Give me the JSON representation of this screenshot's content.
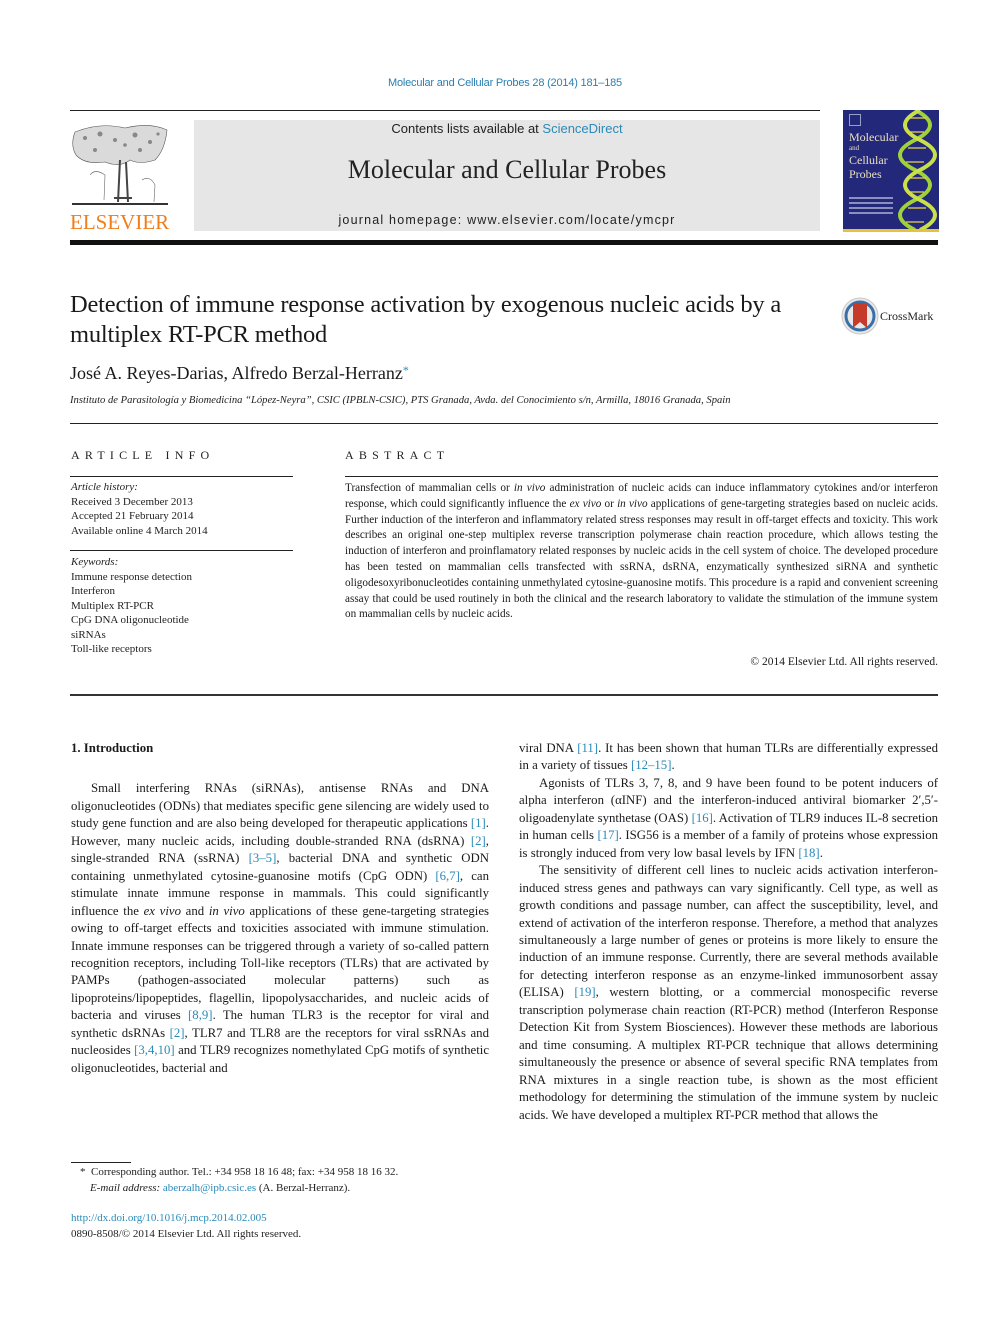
{
  "header": {
    "citation": "Molecular and Cellular Probes 28 (2014) 181–185",
    "contents_prefix": "Contents lists available at ",
    "contents_link": "ScienceDirect",
    "journal_title": "Molecular and Cellular Probes",
    "homepage": "journal homepage: www.elsevier.com/locate/ymcpr",
    "publisher_logo": "ELSEVIER",
    "cover_title_lines": [
      "Molecular",
      "and",
      "Cellular",
      "Probes"
    ],
    "colors": {
      "link": "#2a8ab8",
      "elsevier_orange": "#f07e1b",
      "cover_blue": "#23287a",
      "masthead_gray": "#e6e6e6"
    }
  },
  "article": {
    "title": "Detection of immune response activation by exogenous nucleic acids by a multiplex RT-PCR method",
    "crossmark_label": "CrossMark",
    "authors": "José A. Reyes-Darias, Alfredo Berzal-Herranz",
    "author_mark": "*",
    "affiliation": "Instituto de Parasitología y Biomedicina “López-Neyra”, CSIC (IPBLN-CSIC), PTS Granada, Avda. del Conocimiento s/n, Armilla, 18016 Granada, Spain"
  },
  "article_info": {
    "heading": "ARTICLE INFO",
    "history_label": "Article history:",
    "history": [
      "Received 3 December 2013",
      "Accepted 21 February 2014",
      "Available online 4 March 2014"
    ],
    "keywords_label": "Keywords:",
    "keywords": [
      "Immune response detection",
      "Interferon",
      "Multiplex RT-PCR",
      "CpG DNA oligonucleotide",
      "siRNAs",
      "Toll-like receptors"
    ]
  },
  "abstract": {
    "heading": "ABSTRACT",
    "segments": [
      {
        "t": "Transfection of mammalian cells or "
      },
      {
        "t": "in vivo",
        "i": true
      },
      {
        "t": " administration of nucleic acids can induce inflammatory cytokines and/or interferon response, which could significantly influence the "
      },
      {
        "t": "ex vivo",
        "i": true
      },
      {
        "t": " or "
      },
      {
        "t": "in vivo",
        "i": true
      },
      {
        "t": " applications of gene-targeting strategies based on nucleic acids. Further induction of the interferon and inflammatory related stress responses may result in off-target effects and toxicity. This work describes an original one-step multiplex reverse transcription polymerase chain reaction procedure, which allows testing the induction of interferon and proinflamatory related responses by nucleic acids in the cell system of choice. The developed procedure has been tested on mammalian cells transfected with ssRNA, dsRNA, enzymatically synthesized siRNA and synthetic oligodesoxyribonucleotides containing unmethylated cytosine-guanosine motifs. This procedure is a rapid and convenient screening assay that could be used routinely in both the clinical and the research laboratory to validate the stimulation of the immune system on mammalian cells by nucleic acids."
      }
    ],
    "copyright": "© 2014 Elsevier Ltd. All rights reserved."
  },
  "body": {
    "section_heading": "1.  Introduction",
    "left_paragraphs": [
      [
        {
          "t": "Small interfering RNAs (siRNAs), antisense RNAs and DNA oligonucleotides (ODNs) that mediates specific gene silencing are widely used to study gene function and are also being developed for therapeutic applications "
        },
        {
          "t": "[1]",
          "r": true
        },
        {
          "t": ". However, many nucleic acids, including double-stranded RNA (dsRNA) "
        },
        {
          "t": "[2]",
          "r": true
        },
        {
          "t": ", single-stranded RNA (ssRNA) "
        },
        {
          "t": "[3–5]",
          "r": true
        },
        {
          "t": ", bacterial DNA and synthetic ODN containing unmethylated cytosine-guanosine motifs (CpG ODN) "
        },
        {
          "t": "[6,7]",
          "r": true
        },
        {
          "t": ", can stimulate innate immune response in mammals. This could significantly influence the "
        },
        {
          "t": "ex vivo",
          "i": true
        },
        {
          "t": " and "
        },
        {
          "t": "in vivo",
          "i": true
        },
        {
          "t": " applications of these gene-targeting strategies owing to off-target effects and toxicities associated with immune stimulation. Innate immune responses can be triggered through a variety of so-called pattern recognition receptors, including Toll-like receptors (TLRs) that are activated by PAMPs (pathogen-associated molecular patterns) such as lipoproteins/lipopeptides, flagellin, lipopolysaccharides, and nucleic acids of bacteria and viruses "
        },
        {
          "t": "[8,9]",
          "r": true
        },
        {
          "t": ". The human TLR3 is the receptor for viral and synthetic dsRNAs "
        },
        {
          "t": "[2]",
          "r": true
        },
        {
          "t": ", TLR7 and TLR8 are the receptors for viral ssRNAs and nucleosides "
        },
        {
          "t": "[3,4,10]",
          "r": true
        },
        {
          "t": " and TLR9 recognizes nomethylated CpG motifs of synthetic oligonucleotides, bacterial and"
        }
      ]
    ],
    "right_paragraphs": [
      [
        {
          "t": "viral DNA "
        },
        {
          "t": "[11]",
          "r": true
        },
        {
          "t": ". It has been shown that human TLRs are differentially expressed in a variety of tissues "
        },
        {
          "t": "[12–15]",
          "r": true
        },
        {
          "t": "."
        }
      ],
      [
        {
          "t": "Agonists of TLRs 3, 7, 8, and 9 have been found to be potent inducers of alpha interferon (αINF) and the interferon-induced antiviral biomarker 2′,5′-oligoadenylate synthetase (OAS) "
        },
        {
          "t": "[16]",
          "r": true
        },
        {
          "t": ". Activation of TLR9 induces IL-8 secretion in human cells "
        },
        {
          "t": "[17]",
          "r": true
        },
        {
          "t": ". ISG56 is a member of a family of proteins whose expression is strongly induced from very low basal levels by IFN "
        },
        {
          "t": "[18]",
          "r": true
        },
        {
          "t": "."
        }
      ],
      [
        {
          "t": "The sensitivity of different cell lines to nucleic acids activation interferon-induced stress genes and pathways can vary significantly. Cell type, as well as growth conditions and passage number, can affect the susceptibility, level, and extend of activation of the interferon response. Therefore, a method that analyzes simultaneously a large number of genes or proteins is more likely to ensure the induction of an immune response. Currently, there are several methods available for detecting interferon response as an enzyme-linked immunosorbent assay (ELISA) "
        },
        {
          "t": "[19]",
          "r": true
        },
        {
          "t": ", western blotting, or a commercial monospecific reverse transcription polymerase chain reaction (RT-PCR) method (Interferon Response Detection Kit from System Biosciences). However these methods are laborious and time consuming. A multiplex RT-PCR technique that allows determining simultaneously the presence or absence of several specific RNA templates from RNA mixtures in a single reaction tube, is shown as the most efficient methodology for determining the stimulation of the immune system by nucleic acids. We have developed a multiplex RT-PCR method that allows the"
        }
      ]
    ]
  },
  "footnote": {
    "mark": "*",
    "corresponding": "Corresponding author. Tel.: +34 958 18 16 48; fax: +34 958 18 16 32.",
    "email_label": "E-mail address: ",
    "email": "aberzalh@ipb.csic.es",
    "email_suffix": " (A. Berzal-Herranz).",
    "doi": "http://dx.doi.org/10.1016/j.mcp.2014.02.005",
    "issn_copyright": "0890-8508/© 2014 Elsevier Ltd. All rights reserved."
  }
}
